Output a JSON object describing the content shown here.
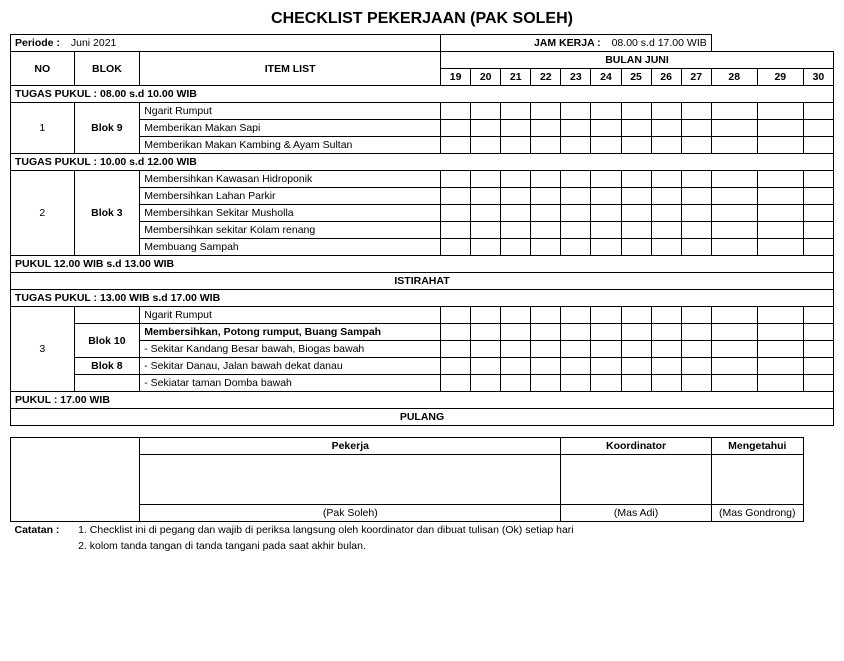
{
  "title": "CHECKLIST PEKERJAAN (PAK SOLEH)",
  "periode_label": "Periode :",
  "periode_value": "Juni 2021",
  "jam_kerja_label": "JAM KERJA :",
  "jam_kerja_value": "08.00 s.d 17.00 WIB",
  "bulan_label": "BULAN JUNI",
  "cols": {
    "no": "NO",
    "blok": "BLOK",
    "item": "ITEM LIST"
  },
  "days": [
    "19",
    "20",
    "21",
    "22",
    "23",
    "24",
    "25",
    "26",
    "27",
    "28",
    "29",
    "30"
  ],
  "sections": [
    {
      "type": "section-header",
      "label": "TUGAS PUKUL : 08.00 s.d 10.00 WIB"
    },
    {
      "type": "group",
      "no": "1",
      "blok": "Blok 9",
      "items": [
        "Ngarit Rumput",
        "Memberikan Makan Sapi",
        "Memberikan Makan Kambing & Ayam Sultan"
      ]
    },
    {
      "type": "section-header",
      "label": "TUGAS PUKUL : 10.00 s.d 12.00 WIB"
    },
    {
      "type": "group",
      "no": "2",
      "blok": "Blok 3",
      "items": [
        "Membersihkan Kawasan Hidroponik",
        "Membersihkan Lahan Parkir",
        "Membersihkan Sekitar Musholla",
        "Membersihkan sekitar Kolam renang",
        "Membuang Sampah"
      ]
    },
    {
      "type": "section-header",
      "label": "PUKUL 12.00 WIB s.d 13.00 WIB"
    },
    {
      "type": "istirahat",
      "label": "ISTIRAHAT"
    },
    {
      "type": "section-header",
      "label": "TUGAS PUKUL : 13.00 WIB s.d 17.00 WIB"
    },
    {
      "type": "group3",
      "no": "3",
      "sub_items": [
        {
          "blok": "",
          "text": "Ngarit Rumput",
          "bold": false
        },
        {
          "blok": "Blok 10",
          "text": "Membersihkan, Potong rumput, Buang Sampah",
          "bold": true
        },
        {
          "blok": "",
          "text": "- Sekitar Kandang Besar bawah, Biogas bawah",
          "bold": false
        },
        {
          "blok": "Blok 8",
          "text": "- Sekitar Danau, Jalan bawah dekat danau",
          "bold": false
        },
        {
          "blok": "",
          "text": "- Sekiatar taman Domba bawah",
          "bold": false
        }
      ]
    },
    {
      "type": "section-header",
      "label": "PUKUL : 17.00 WIB"
    },
    {
      "type": "pulang",
      "label": "PULANG"
    }
  ],
  "signature": {
    "pekerja": "Pekerja",
    "koordinator": "Koordinator",
    "mengetahui": "Mengetahui",
    "pak_soleh": "(Pak Soleh)",
    "mas_adi": "(Mas Adi)",
    "mas_gondrong": "(Mas Gondrong)"
  },
  "catatan": {
    "label": "Catatan :",
    "lines": [
      "1. Checklist ini di pegang dan wajib di periksa langsung oleh koordinator dan dibuat tulisan (Ok) setiap hari",
      "2. kolom tanda tangan di tanda tangani pada saat akhir bulan."
    ]
  }
}
